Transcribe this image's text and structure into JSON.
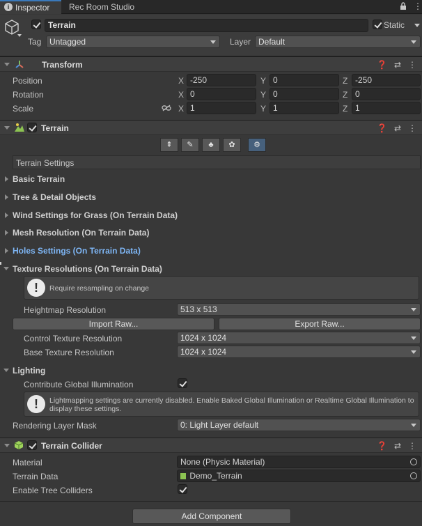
{
  "tabs": [
    {
      "label": "Inspector",
      "icon": "info-icon"
    },
    {
      "label": "Rec Room Studio"
    }
  ],
  "tabbar_icons": [
    "lock-icon",
    "kebab-menu-icon"
  ],
  "object": {
    "name": "Terrain",
    "active": true,
    "static_label": "Static",
    "static_checked": true,
    "tag_label": "Tag",
    "tag_value": "Untagged",
    "layer_label": "Layer",
    "layer_value": "Default"
  },
  "transform": {
    "title": "Transform",
    "rows": [
      {
        "label": "Position",
        "x": "-250",
        "y": "0",
        "z": "-250"
      },
      {
        "label": "Rotation",
        "x": "0",
        "y": "0",
        "z": "0"
      },
      {
        "label": "Scale",
        "x": "1",
        "y": "1",
        "z": "1"
      }
    ],
    "axis": {
      "x": "X",
      "y": "Y",
      "z": "Z"
    }
  },
  "terrain": {
    "title": "Terrain",
    "enabled": true,
    "tools": [
      "raise-lower-icon",
      "paint-texture-icon",
      "paint-trees-icon",
      "paint-details-icon",
      "terrain-settings-icon"
    ],
    "active_tool": 4,
    "settings_header": "Terrain Settings",
    "sections": {
      "basic": "Basic Terrain",
      "tree": "Tree & Detail Objects",
      "wind": "Wind Settings for Grass (On Terrain Data)",
      "mesh": "Mesh Resolution (On Terrain Data)",
      "holes": "Holes Settings (On Terrain Data)",
      "texture": "Texture Resolutions (On Terrain Data)",
      "lighting": "Lighting"
    },
    "texture": {
      "help": "Require resampling on change",
      "heightmap_label": "Heightmap Resolution",
      "heightmap_value": "513 x 513",
      "import_raw": "Import Raw...",
      "export_raw": "Export Raw...",
      "control_label": "Control Texture Resolution",
      "control_value": "1024 x 1024",
      "base_label": "Base Texture Resolution",
      "base_value": "1024 x 1024"
    },
    "lighting": {
      "gi_label": "Contribute Global Illumination",
      "gi_checked": true,
      "help": "Lightmapping settings are currently disabled. Enable Baked Global Illumination or Realtime Global Illumination to display these settings.",
      "mask_label": "Rendering Layer Mask",
      "mask_value": "0: Light Layer default"
    }
  },
  "collider": {
    "title": "Terrain Collider",
    "enabled": true,
    "material_label": "Material",
    "material_value": "None (Physic Material)",
    "data_label": "Terrain Data",
    "data_value": "Demo_Terrain",
    "trees_label": "Enable Tree Colliders",
    "trees_checked": true
  },
  "add_component": "Add Component",
  "colors": {
    "background": "#383838",
    "field": "#2a2a2a",
    "link_section": "#7eb6f5",
    "active_tool": "#46607c"
  }
}
